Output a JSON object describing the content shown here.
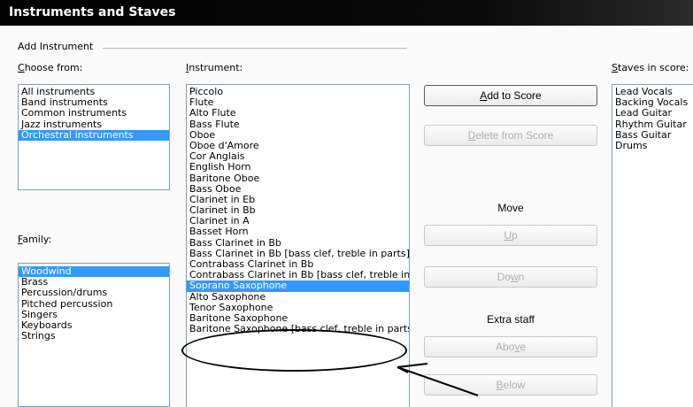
{
  "window": {
    "title": "Instruments and Staves"
  },
  "add_instrument": {
    "group_label": "Add Instrument",
    "choose_from": {
      "label_first": "C",
      "label_rest": "hoose from:",
      "items": [
        "All instruments",
        "Band instruments",
        "Common instruments",
        "Jazz instruments",
        "Orchestral instruments"
      ],
      "selected_index": 4
    },
    "family": {
      "label_first": "F",
      "label_rest": "amily:",
      "items": [
        "Woodwind",
        "Brass",
        "Percussion/drums",
        "Pitched percussion",
        "Singers",
        "Keyboards",
        "Strings"
      ],
      "selected_index": 0
    },
    "instrument": {
      "label_first": "I",
      "label_rest": "nstrument:",
      "items": [
        "Piccolo",
        "Flute",
        "Alto Flute",
        "Bass Flute",
        "Oboe",
        "Oboe d'Amore",
        "Cor Anglais",
        "English Horn",
        "Baritone Oboe",
        "Bass Oboe",
        "Clarinet in Eb",
        "Clarinet in Bb",
        "Clarinet in A",
        "Basset Horn",
        "Bass Clarinet in Bb",
        "Bass Clarinet in Bb [bass clef, treble in parts]",
        "Contrabass Clarinet in Bb",
        "Contrabass Clarinet in Bb [bass clef, treble in parts]",
        "Soprano Saxophone",
        "Alto Saxophone",
        "Tenor Saxophone",
        "Baritone Saxophone",
        "Baritone Saxophone [bass clef, treble in parts]"
      ],
      "selected_index": 18
    }
  },
  "buttons": {
    "add_to_score_first": "A",
    "add_to_score_rest": "dd to Score",
    "delete_from_score_first": "D",
    "delete_from_score_rest": "elete from Score",
    "move_label": "Move",
    "up_first": "U",
    "up_rest": "p",
    "down_pre": "Do",
    "down_u": "w",
    "down_post": "n",
    "extra_staff_label": "Extra staff",
    "above_pre": "Abo",
    "above_u": "v",
    "above_post": "e",
    "below_first": "B",
    "below_rest": "elow"
  },
  "staves": {
    "label_first": "S",
    "label_rest": "taves in score:",
    "items": [
      "Lead Vocals",
      "Backing Vocals",
      "Lead Guitar",
      "Rhythm Guitar",
      "Bass Guitar",
      "Drums"
    ]
  }
}
